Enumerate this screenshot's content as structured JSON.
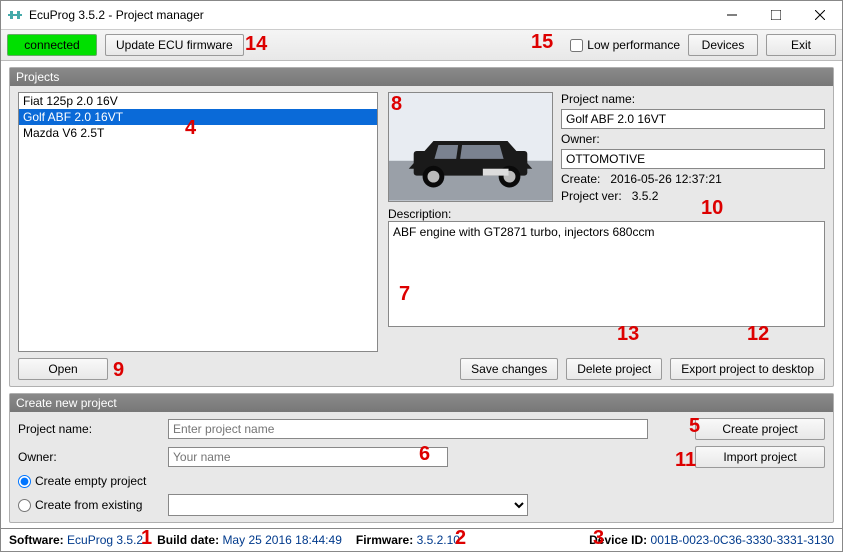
{
  "window": {
    "title": "EcuProg 3.5.2 - Project manager"
  },
  "toolbar": {
    "connected": "connected",
    "update_fw": "Update ECU firmware",
    "low_perf": "Low performance",
    "devices": "Devices",
    "exit": "Exit"
  },
  "projects": {
    "title": "Projects",
    "items": [
      "Fiat 125p 2.0 16V",
      "Golf ABF 2.0 16VT",
      "Mazda V6 2.5T"
    ],
    "selected_index": 1,
    "project_name_label": "Project name:",
    "project_name": "Golf ABF 2.0 16VT",
    "owner_label": "Owner:",
    "owner": "OTTOMOTIVE",
    "create_label": "Create:",
    "create_value": "2016-05-26 12:37:21",
    "project_ver_label": "Project ver:",
    "project_ver": "3.5.2",
    "description_label": "Description:",
    "description": "ABF engine with GT2871 turbo, injectors 680ccm",
    "open": "Open",
    "save": "Save changes",
    "delete": "Delete project",
    "export": "Export project to desktop"
  },
  "newproj": {
    "title": "Create new project",
    "pname_label": "Project name:",
    "pname_placeholder": "Enter project name",
    "owner_label": "Owner:",
    "owner_placeholder": "Your name",
    "empty": "Create empty project",
    "from_existing": "Create from existing",
    "create": "Create project",
    "import": "Import project"
  },
  "status": {
    "software_label": "Software:",
    "software": "EcuProg 3.5.2",
    "build_label": "Build date:",
    "build": "May 25 2016 18:44:49",
    "fw_label": "Firmware:",
    "fw": "3.5.2.10",
    "devid_label": "Device ID:",
    "devid": "001B-0023-0C36-3330-3331-3130"
  },
  "annotations": {
    "1": "1",
    "2": "2",
    "3": "3",
    "4": "4",
    "5": "5",
    "6": "6",
    "7": "7",
    "8": "8",
    "9": "9",
    "10": "10",
    "11": "11",
    "12": "12",
    "13": "13",
    "14": "14",
    "15": "15"
  }
}
